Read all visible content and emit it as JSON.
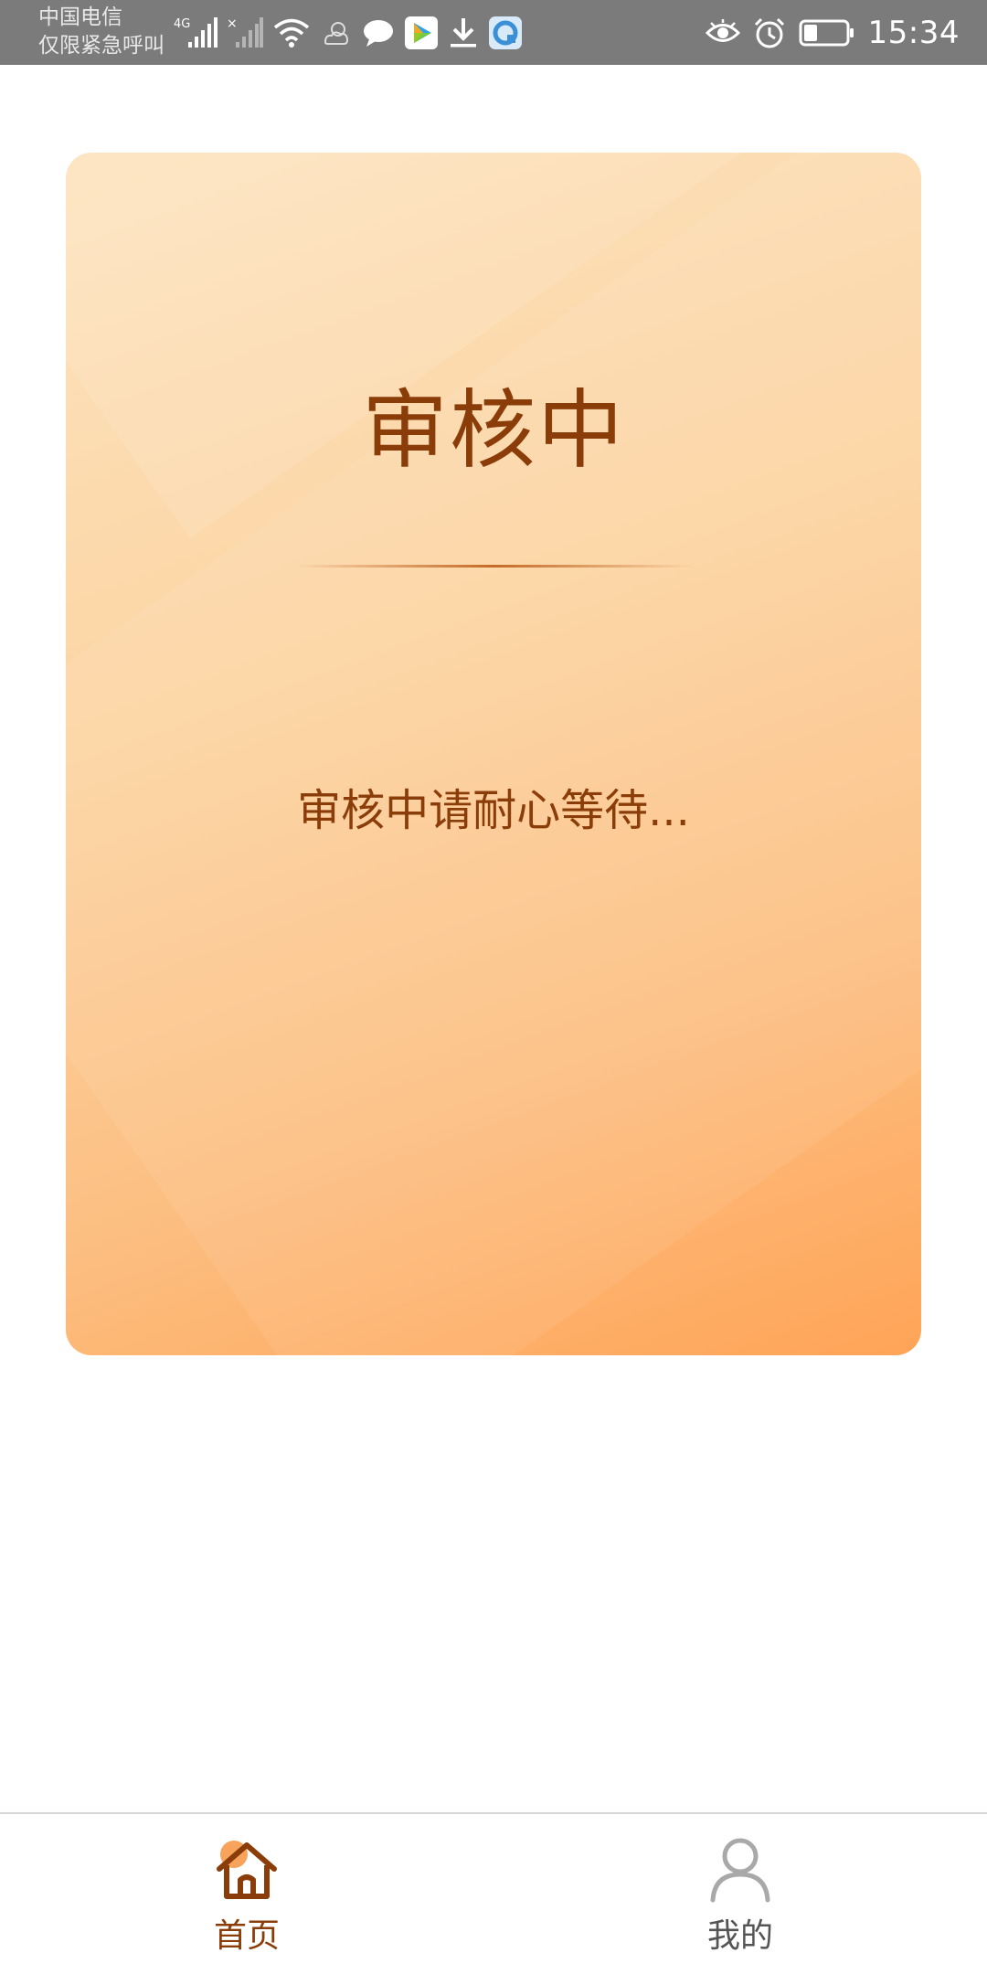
{
  "status_bar": {
    "carrier_line1": "中国电信",
    "carrier_line2": "仅限紧急呼叫",
    "network_type": "4G",
    "time": "15:34",
    "icons_left": [
      "signal-icon",
      "no-signal-icon",
      "wifi-icon",
      "weather-icon",
      "message-icon",
      "video-app-icon",
      "download-icon",
      "browser-app-icon"
    ],
    "icons_right": [
      "eye-icon",
      "alarm-icon",
      "battery-icon"
    ]
  },
  "card": {
    "title": "审核中",
    "message": "审核中请耐心等待...",
    "gradient_colors": [
      "#fde3bf",
      "#fcd4a2",
      "#fcbf82",
      "#ffa457"
    ],
    "text_color": "#8b3d09"
  },
  "bottom_nav": {
    "items": [
      {
        "label": "首页",
        "icon": "home-icon",
        "active": true,
        "color": "#8b3d09",
        "accent": "#f7a35c"
      },
      {
        "label": "我的",
        "icon": "user-icon",
        "active": false,
        "color": "#555555"
      }
    ]
  }
}
